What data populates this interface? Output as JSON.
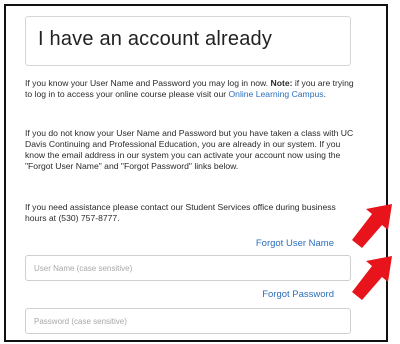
{
  "header": {
    "title": "I have an account already"
  },
  "intro": {
    "p1_prefix": "If you know your User Name and Password you may log in now. ",
    "p1_note_label": "Note:",
    "p1_after_note": " if you are trying to log in to access your online course please visit our ",
    "p1_link": "Online Learning Campus",
    "p1_end": ".",
    "p2": "If you do not know your User Name and Password but you have taken a class with UC Davis Continuing and Professional Education, you are already in our system. If you know the email address in our system you can activate your account now using the \"Forgot User Name\" and \"Forgot Password\" links below.",
    "p3": "If you need assistance please contact our Student Services office during business hours at (530) 757-8777."
  },
  "links": {
    "forgot_username": "Forgot User Name",
    "forgot_password": "Forgot Password"
  },
  "fields": {
    "username_placeholder": "User Name (case sensitive)",
    "password_placeholder": "Password (case sensitive)"
  },
  "colors": {
    "link": "#2a6ebb",
    "arrow": "#e8141c"
  },
  "icons": {
    "arrow_username": "red-arrow-icon",
    "arrow_password": "red-arrow-icon"
  }
}
